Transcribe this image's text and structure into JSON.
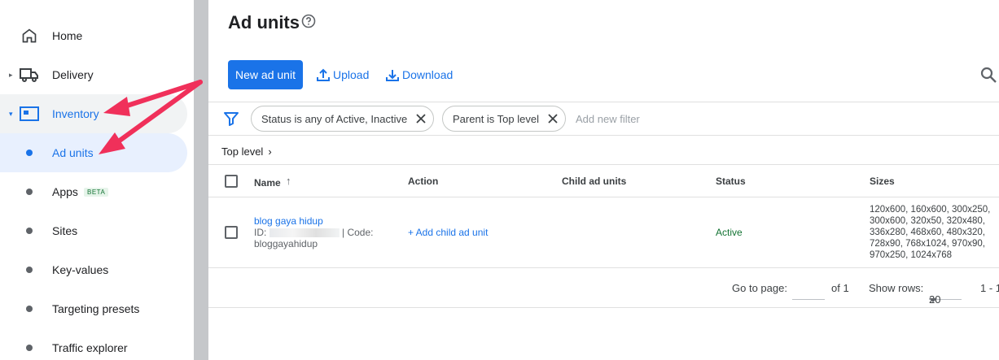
{
  "sidebar": {
    "items": [
      {
        "label": "Home",
        "icon": "home-icon"
      },
      {
        "label": "Delivery",
        "icon": "truck-icon"
      },
      {
        "label": "Inventory",
        "icon": "inventory-icon"
      },
      {
        "label": "Ad units"
      },
      {
        "label": "Apps",
        "badge": "BETA"
      },
      {
        "label": "Sites"
      },
      {
        "label": "Key-values"
      },
      {
        "label": "Targeting presets"
      },
      {
        "label": "Traffic explorer"
      }
    ]
  },
  "header": {
    "title": "Ad units",
    "new_button": "New ad unit",
    "upload": "Upload",
    "download": "Download"
  },
  "filters": {
    "chips": [
      "Status is any of Active, Inactive",
      "Parent is Top level"
    ],
    "add_placeholder": "Add new filter"
  },
  "breadcrumb": {
    "label": "Top level",
    "chevron": "›"
  },
  "table": {
    "columns": [
      "Name",
      "Action",
      "Child ad units",
      "Status",
      "Sizes"
    ],
    "rows": [
      {
        "name": "blog gaya hidup",
        "id_prefix": "ID: ",
        "code_text": " | Code: bloggayahidup",
        "action": "+ Add child ad unit",
        "status": "Active",
        "sizes": "120x600, 160x600, 300x250, 300x600, 320x50, 320x480, 336x280, 468x60, 480x320, 728x90, 768x1024, 970x90, 970x250, 1024x768"
      }
    ]
  },
  "pagination": {
    "go_to_page": "Go to page:",
    "of_pages": "of 1",
    "show_rows": "Show rows:",
    "rows_value": "20",
    "range": "1 - 1"
  },
  "colors": {
    "accent": "#1a73e8",
    "annotation": "#f0305a",
    "active_status": "#137333"
  }
}
